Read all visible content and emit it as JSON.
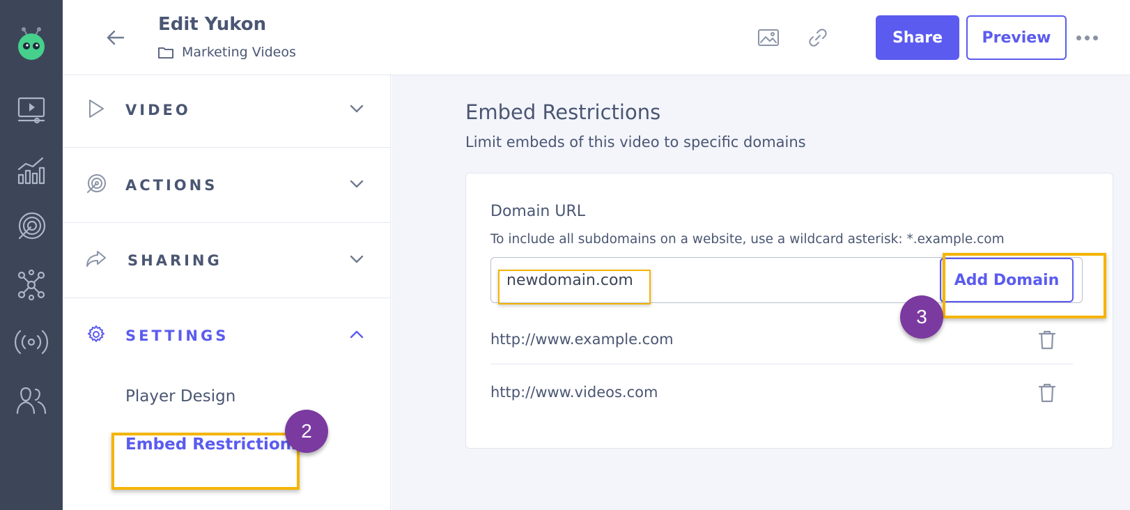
{
  "header": {
    "title": "Edit Yukon",
    "folder": "Marketing Videos",
    "share_label": "Share",
    "preview_label": "Preview"
  },
  "sidebar": {
    "sections": [
      {
        "label": "VIDEO",
        "icon": "play-icon",
        "expanded": false
      },
      {
        "label": "ACTIONS",
        "icon": "target-icon",
        "expanded": false
      },
      {
        "label": "SHARING",
        "icon": "share-arrow-icon",
        "expanded": false
      },
      {
        "label": "SETTINGS",
        "icon": "gear-icon",
        "expanded": true
      }
    ],
    "settings_items": [
      {
        "label": "Player Design",
        "active": false
      },
      {
        "label": "Embed Restrictions",
        "active": true
      }
    ]
  },
  "main": {
    "title": "Embed Restrictions",
    "subtitle": "Limit embeds of this video to specific domains",
    "domain_label": "Domain URL",
    "help_text": "To include all subdomains on a website, use a wildcard asterisk: *.example.com",
    "input_value": "newdomain.com",
    "add_button_label": "Add Domain",
    "domains": [
      "http://www.example.com",
      "http://www.videos.com"
    ]
  },
  "annotations": {
    "step_2": "2",
    "step_3": "3"
  },
  "colors": {
    "accent": "#5b5bf0",
    "rail": "#3c4658",
    "highlight": "#f5b400",
    "callout": "#7b3aa0"
  }
}
